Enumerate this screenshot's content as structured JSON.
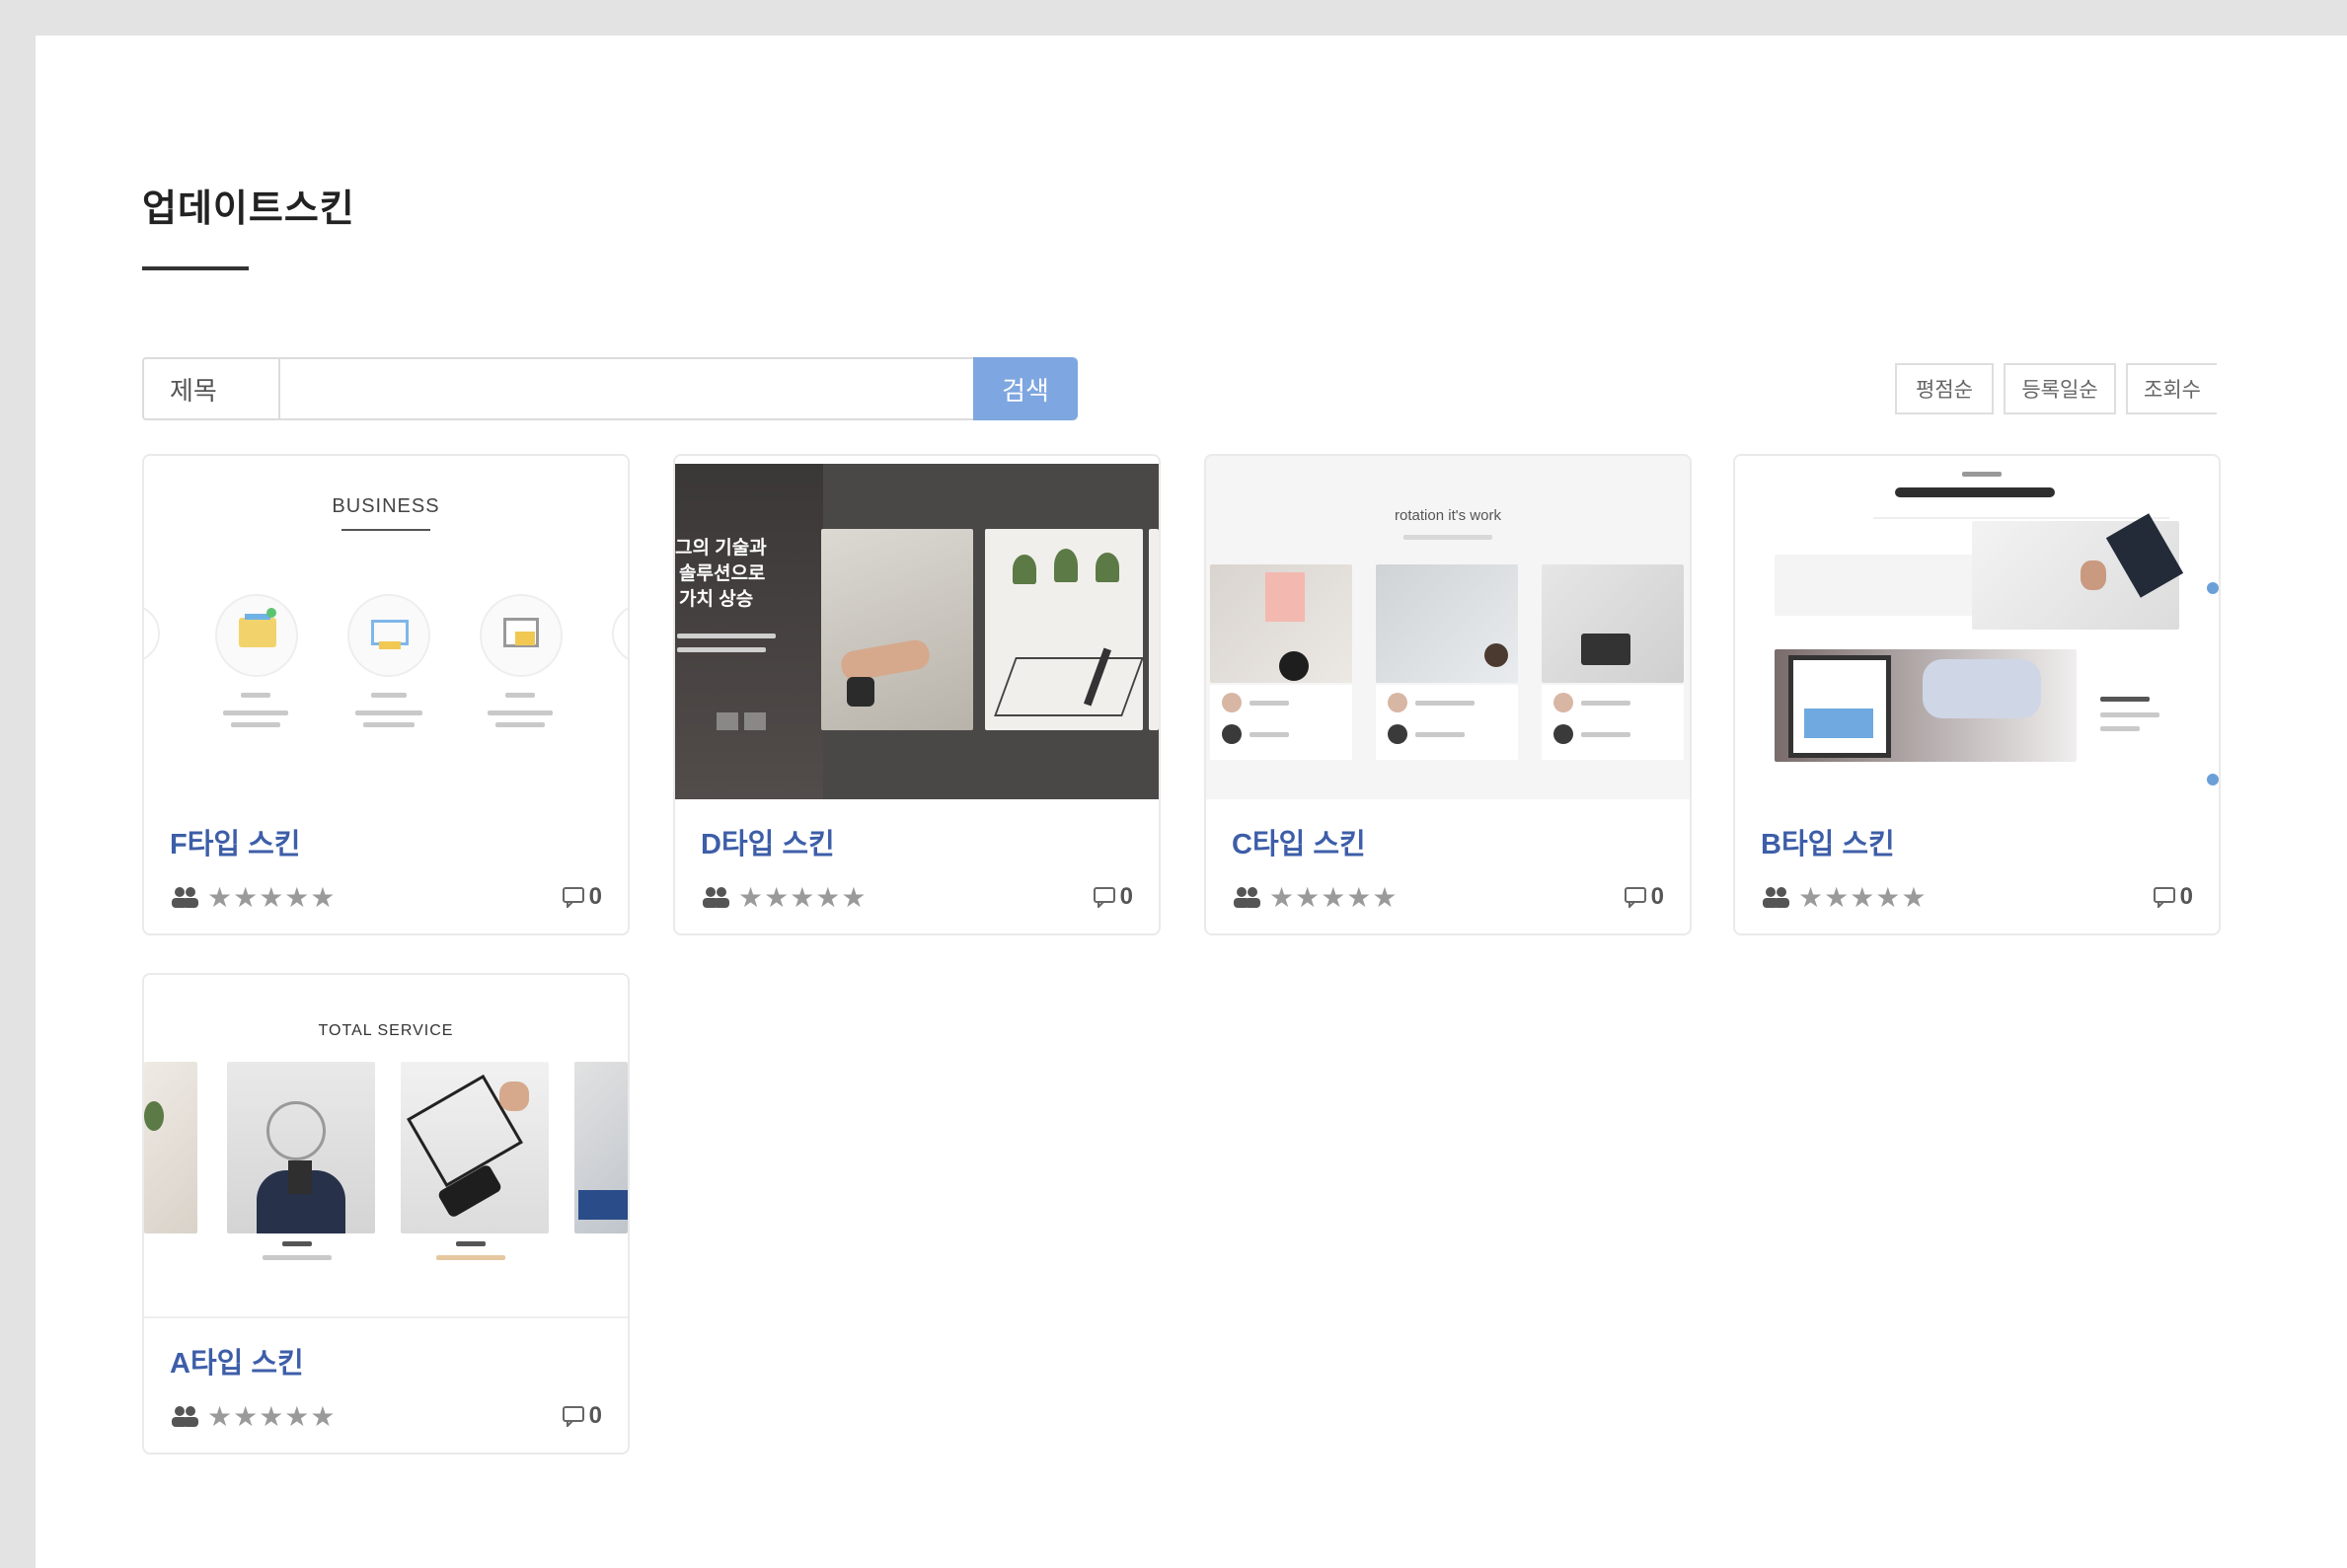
{
  "page": {
    "title": "업데이트스킨"
  },
  "search": {
    "field_label": "제목",
    "placeholder": "",
    "button_label": "검색"
  },
  "sort": {
    "options": [
      "평점순",
      "등록일순",
      "조회수"
    ]
  },
  "cards": [
    {
      "name": "F타입 스킨",
      "comment_count": "0",
      "thumb_heading": "BUSINESS"
    },
    {
      "name": "D타입 스킨",
      "comment_count": "0",
      "thumb_text": [
        "그의 기술과",
        "솔루션으로",
        "가치 상승"
      ]
    },
    {
      "name": "C타입 스킨",
      "comment_count": "0",
      "thumb_heading": "rotation it's work"
    },
    {
      "name": "B타입 스킨",
      "comment_count": "0"
    },
    {
      "name": "A타입 스킨",
      "comment_count": "0",
      "thumb_heading": "TOTAL SERVICE"
    }
  ],
  "rating": {
    "stars": "★★★★★",
    "value": 0,
    "max": 5
  },
  "icons": {
    "people": "people-icon",
    "comment": "comment-icon",
    "star": "star-icon"
  },
  "colors": {
    "accent": "#7ea6e0",
    "title_link": "#3d5ea8",
    "star": "#9a9a9a"
  }
}
